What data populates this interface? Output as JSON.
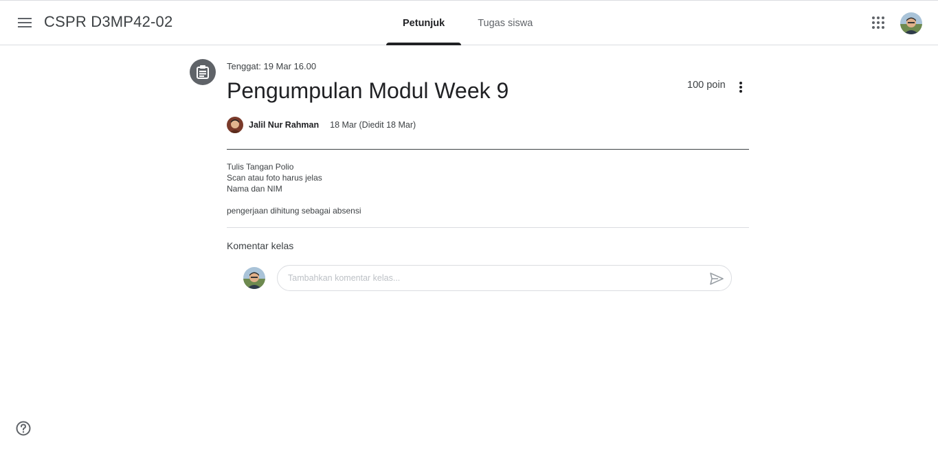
{
  "header": {
    "class_title": "CSPR D3MP42-02",
    "tabs": [
      {
        "label": "Petunjuk",
        "active": true
      },
      {
        "label": "Tugas siswa",
        "active": false
      }
    ]
  },
  "assignment": {
    "due": "Tenggat: 19 Mar 16.00",
    "title": "Pengumpulan Modul Week 9",
    "points": "100 poin",
    "author": "Jalil Nur Rahman",
    "date": "18 Mar (Diedit 18 Mar)",
    "instructions": [
      "Tulis Tangan Polio",
      "Scan atau foto harus jelas",
      "Nama dan NIM",
      "",
      "pengerjaan dihitung sebagai absensi"
    ]
  },
  "comments": {
    "title": "Komentar kelas",
    "placeholder": "Tambahkan komentar kelas..."
  },
  "icons": {
    "menu": "menu-icon",
    "apps": "apps-grid-icon",
    "assignment": "assignment-icon",
    "more": "more-vert-icon",
    "send": "send-icon",
    "help": "help-icon"
  },
  "colors": {
    "text_primary": "#202124",
    "text_secondary": "#3c4043",
    "icon_bg": "#5f6368",
    "divider": "#dadce0"
  }
}
